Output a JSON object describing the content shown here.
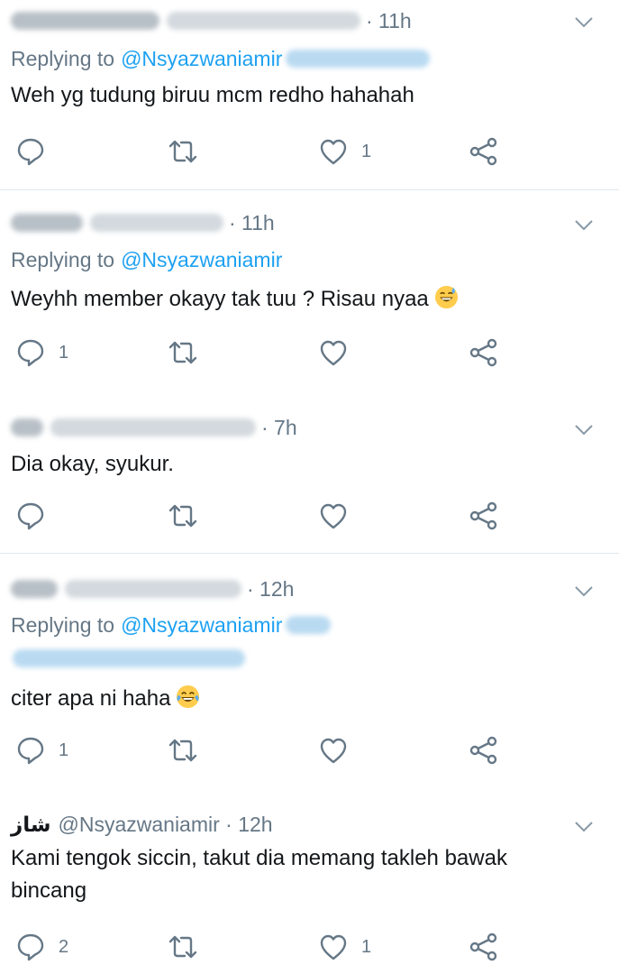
{
  "tweets": [
    {
      "time": "· 11h",
      "replying_prefix": "Replying to",
      "replying_handle": "@Nsyazwaniamir",
      "text": "Weh yg tudung biruu mcm redho hahahah",
      "reply_count": "",
      "like_count": "1"
    },
    {
      "time": "· 11h",
      "replying_prefix": "Replying to",
      "replying_handle": "@Nsyazwaniamir",
      "text": "Weyhh member okayy tak tuu ? Risau nyaa",
      "emoji": "grinning-sweat-emoji",
      "reply_count": "1",
      "like_count": ""
    },
    {
      "time": "· 7h",
      "text": "Dia okay, syukur.",
      "reply_count": "",
      "like_count": ""
    },
    {
      "time": "· 12h",
      "replying_prefix": "Replying to",
      "replying_handle": "@Nsyazwaniamir",
      "text": "citer apa ni haha",
      "emoji": "tears-of-joy-emoji",
      "reply_count": "1",
      "like_count": ""
    },
    {
      "name": "شاز",
      "handle_time": "@Nsyazwaniamir · 12h",
      "text_line1": "Kami tengok siccin, takut dia memang takleh bawak",
      "text_line2": "bincang",
      "reply_count": "2",
      "like_count": "1"
    }
  ],
  "colors": {
    "secondary_text": "#657786",
    "link_blue": "#1da1f2",
    "divider": "#e1e8ed",
    "icon_gray": "#657786"
  },
  "icons": [
    "reply-icon",
    "retweet-icon",
    "like-icon",
    "share-icon",
    "chevron-down-icon"
  ]
}
